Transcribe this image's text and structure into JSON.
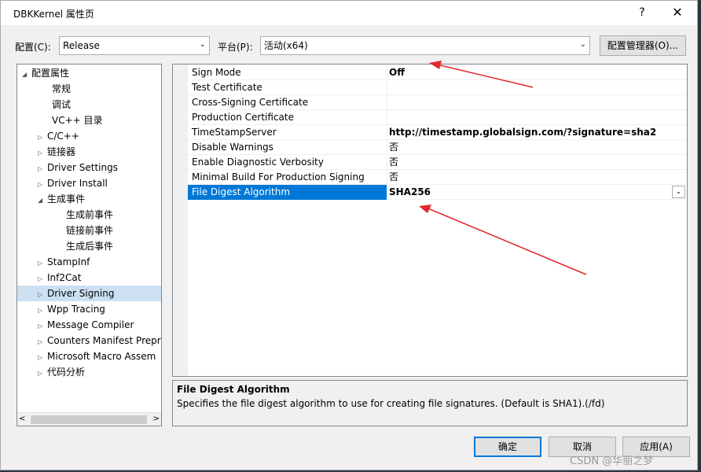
{
  "window": {
    "title": "DBKKernel 属性页",
    "help": "?",
    "close": "✕"
  },
  "toolbar": {
    "config_label": "配置(C):",
    "config_value": "Release",
    "platform_label": "平台(P):",
    "platform_value": "活动(x64)",
    "config_manager": "配置管理器(O)..."
  },
  "tree": {
    "items": [
      {
        "label": "配置属性",
        "expander": "◢"
      },
      {
        "label": "常规",
        "expander": ""
      },
      {
        "label": "调试",
        "expander": ""
      },
      {
        "label": "VC++ 目录",
        "expander": ""
      },
      {
        "label": "C/C++",
        "expander": "▷"
      },
      {
        "label": "链接器",
        "expander": "▷"
      },
      {
        "label": "Driver Settings",
        "expander": "▷"
      },
      {
        "label": "Driver Install",
        "expander": "▷"
      },
      {
        "label": "生成事件",
        "expander": "◢"
      },
      {
        "label": "生成前事件",
        "expander": ""
      },
      {
        "label": "链接前事件",
        "expander": ""
      },
      {
        "label": "生成后事件",
        "expander": ""
      },
      {
        "label": "StampInf",
        "expander": "▷"
      },
      {
        "label": "Inf2Cat",
        "expander": "▷"
      },
      {
        "label": "Driver Signing",
        "expander": "▷"
      },
      {
        "label": "Wpp Tracing",
        "expander": "▷"
      },
      {
        "label": "Message Compiler",
        "expander": "▷"
      },
      {
        "label": "Counters Manifest Prepr",
        "expander": "▷"
      },
      {
        "label": "Microsoft Macro Assem",
        "expander": "▷"
      },
      {
        "label": "代码分析",
        "expander": "▷"
      }
    ],
    "scroll_left": "<",
    "scroll_right": ">"
  },
  "properties": [
    {
      "name": "Sign Mode",
      "value": "Off"
    },
    {
      "name": "Test Certificate",
      "value": ""
    },
    {
      "name": "Cross-Signing Certificate",
      "value": ""
    },
    {
      "name": "Production Certificate",
      "value": ""
    },
    {
      "name": "TimeStampServer",
      "value": "http://timestamp.globalsign.com/?signature=sha2"
    },
    {
      "name": "Disable Warnings",
      "value": "否"
    },
    {
      "name": "Enable Diagnostic Verbosity",
      "value": "否"
    },
    {
      "name": "Minimal Build For Production Signing",
      "value": "否"
    },
    {
      "name": "File Digest Algorithm",
      "value": "SHA256"
    }
  ],
  "description": {
    "title": "File Digest Algorithm",
    "text": "Specifies the file digest algorithm to use for creating file signatures. (Default is SHA1).(/fd)"
  },
  "buttons": {
    "ok": "确定",
    "cancel": "取消",
    "apply": "应用(A)"
  },
  "watermark": "CSDN @华丽之梦",
  "colors": {
    "selection": "#0078d7",
    "arrow": "#e0282e"
  }
}
